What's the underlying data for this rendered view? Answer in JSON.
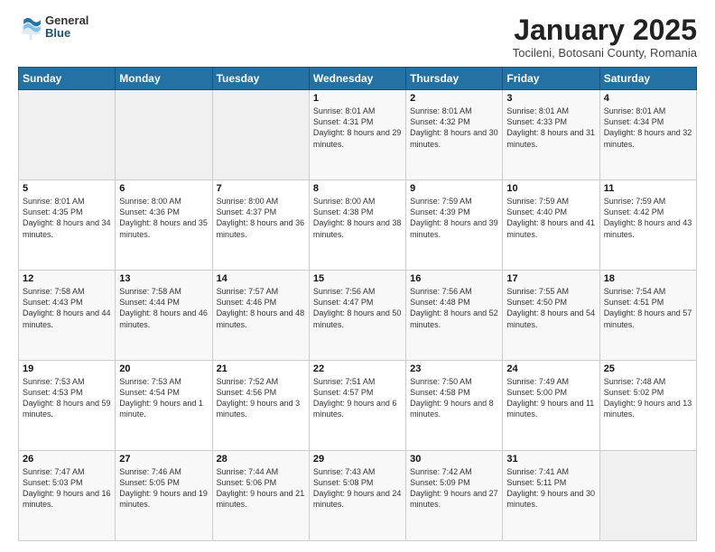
{
  "logo": {
    "general": "General",
    "blue": "Blue"
  },
  "header": {
    "month": "January 2025",
    "location": "Tocileni, Botosani County, Romania"
  },
  "weekdays": [
    "Sunday",
    "Monday",
    "Tuesday",
    "Wednesday",
    "Thursday",
    "Friday",
    "Saturday"
  ],
  "weeks": [
    [
      {
        "day": "",
        "info": ""
      },
      {
        "day": "",
        "info": ""
      },
      {
        "day": "",
        "info": ""
      },
      {
        "day": "1",
        "info": "Sunrise: 8:01 AM\nSunset: 4:31 PM\nDaylight: 8 hours and 29 minutes."
      },
      {
        "day": "2",
        "info": "Sunrise: 8:01 AM\nSunset: 4:32 PM\nDaylight: 8 hours and 30 minutes."
      },
      {
        "day": "3",
        "info": "Sunrise: 8:01 AM\nSunset: 4:33 PM\nDaylight: 8 hours and 31 minutes."
      },
      {
        "day": "4",
        "info": "Sunrise: 8:01 AM\nSunset: 4:34 PM\nDaylight: 8 hours and 32 minutes."
      }
    ],
    [
      {
        "day": "5",
        "info": "Sunrise: 8:01 AM\nSunset: 4:35 PM\nDaylight: 8 hours and 34 minutes."
      },
      {
        "day": "6",
        "info": "Sunrise: 8:00 AM\nSunset: 4:36 PM\nDaylight: 8 hours and 35 minutes."
      },
      {
        "day": "7",
        "info": "Sunrise: 8:00 AM\nSunset: 4:37 PM\nDaylight: 8 hours and 36 minutes."
      },
      {
        "day": "8",
        "info": "Sunrise: 8:00 AM\nSunset: 4:38 PM\nDaylight: 8 hours and 38 minutes."
      },
      {
        "day": "9",
        "info": "Sunrise: 7:59 AM\nSunset: 4:39 PM\nDaylight: 8 hours and 39 minutes."
      },
      {
        "day": "10",
        "info": "Sunrise: 7:59 AM\nSunset: 4:40 PM\nDaylight: 8 hours and 41 minutes."
      },
      {
        "day": "11",
        "info": "Sunrise: 7:59 AM\nSunset: 4:42 PM\nDaylight: 8 hours and 43 minutes."
      }
    ],
    [
      {
        "day": "12",
        "info": "Sunrise: 7:58 AM\nSunset: 4:43 PM\nDaylight: 8 hours and 44 minutes."
      },
      {
        "day": "13",
        "info": "Sunrise: 7:58 AM\nSunset: 4:44 PM\nDaylight: 8 hours and 46 minutes."
      },
      {
        "day": "14",
        "info": "Sunrise: 7:57 AM\nSunset: 4:46 PM\nDaylight: 8 hours and 48 minutes."
      },
      {
        "day": "15",
        "info": "Sunrise: 7:56 AM\nSunset: 4:47 PM\nDaylight: 8 hours and 50 minutes."
      },
      {
        "day": "16",
        "info": "Sunrise: 7:56 AM\nSunset: 4:48 PM\nDaylight: 8 hours and 52 minutes."
      },
      {
        "day": "17",
        "info": "Sunrise: 7:55 AM\nSunset: 4:50 PM\nDaylight: 8 hours and 54 minutes."
      },
      {
        "day": "18",
        "info": "Sunrise: 7:54 AM\nSunset: 4:51 PM\nDaylight: 8 hours and 57 minutes."
      }
    ],
    [
      {
        "day": "19",
        "info": "Sunrise: 7:53 AM\nSunset: 4:53 PM\nDaylight: 8 hours and 59 minutes."
      },
      {
        "day": "20",
        "info": "Sunrise: 7:53 AM\nSunset: 4:54 PM\nDaylight: 9 hours and 1 minute."
      },
      {
        "day": "21",
        "info": "Sunrise: 7:52 AM\nSunset: 4:56 PM\nDaylight: 9 hours and 3 minutes."
      },
      {
        "day": "22",
        "info": "Sunrise: 7:51 AM\nSunset: 4:57 PM\nDaylight: 9 hours and 6 minutes."
      },
      {
        "day": "23",
        "info": "Sunrise: 7:50 AM\nSunset: 4:58 PM\nDaylight: 9 hours and 8 minutes."
      },
      {
        "day": "24",
        "info": "Sunrise: 7:49 AM\nSunset: 5:00 PM\nDaylight: 9 hours and 11 minutes."
      },
      {
        "day": "25",
        "info": "Sunrise: 7:48 AM\nSunset: 5:02 PM\nDaylight: 9 hours and 13 minutes."
      }
    ],
    [
      {
        "day": "26",
        "info": "Sunrise: 7:47 AM\nSunset: 5:03 PM\nDaylight: 9 hours and 16 minutes."
      },
      {
        "day": "27",
        "info": "Sunrise: 7:46 AM\nSunset: 5:05 PM\nDaylight: 9 hours and 19 minutes."
      },
      {
        "day": "28",
        "info": "Sunrise: 7:44 AM\nSunset: 5:06 PM\nDaylight: 9 hours and 21 minutes."
      },
      {
        "day": "29",
        "info": "Sunrise: 7:43 AM\nSunset: 5:08 PM\nDaylight: 9 hours and 24 minutes."
      },
      {
        "day": "30",
        "info": "Sunrise: 7:42 AM\nSunset: 5:09 PM\nDaylight: 9 hours and 27 minutes."
      },
      {
        "day": "31",
        "info": "Sunrise: 7:41 AM\nSunset: 5:11 PM\nDaylight: 9 hours and 30 minutes."
      },
      {
        "day": "",
        "info": ""
      }
    ]
  ]
}
